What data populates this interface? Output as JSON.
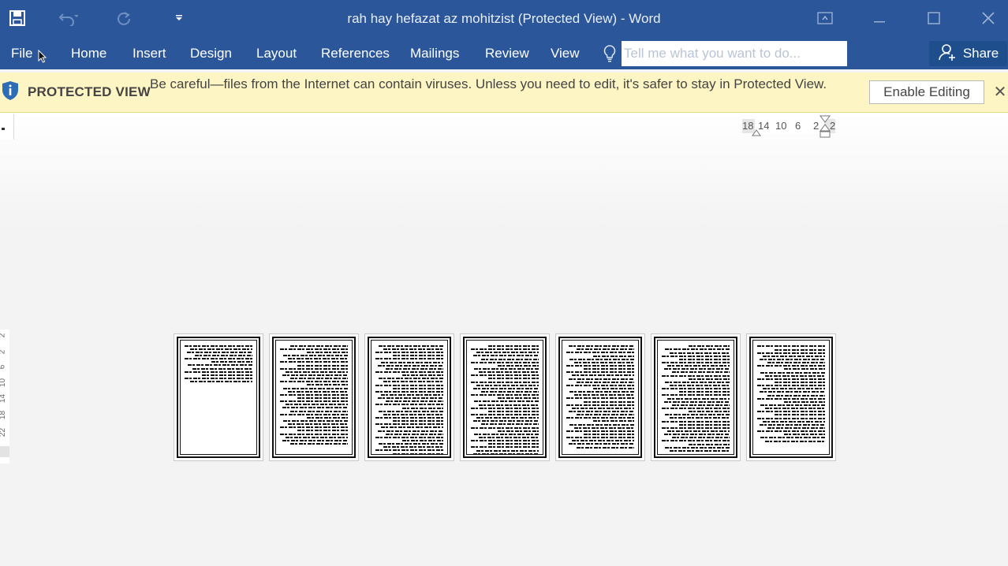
{
  "window": {
    "title": "rah hay hefazat az mohitzist (Protected View) - Word"
  },
  "ribbon": {
    "tabs": [
      "File",
      "Home",
      "Insert",
      "Design",
      "Layout",
      "References",
      "Mailings",
      "Review",
      "View"
    ],
    "tell_me_placeholder": "Tell me what you want to do...",
    "share_label": "Share"
  },
  "protected_view": {
    "title": "PROTECTED VIEW",
    "message": "Be careful—files from the Internet can contain viruses. Unless you need to edit, it's safer to stay in Protected View.",
    "enable_button": "Enable Editing"
  },
  "ruler": {
    "numbers": [
      "18",
      "14",
      "10",
      "6",
      "2",
      "2"
    ]
  },
  "vertical_ruler": {
    "numbers": [
      "2",
      "2",
      "6",
      "10",
      "14",
      "18",
      "22"
    ]
  },
  "pages": [
    {
      "lines": 12
    },
    {
      "lines": 31
    },
    {
      "lines": 34
    },
    {
      "lines": 34
    },
    {
      "lines": 32
    },
    {
      "lines": 33
    },
    {
      "lines": 30
    }
  ],
  "colors": {
    "accent": "#2b579a",
    "protected_bar": "#fdf5c4"
  }
}
